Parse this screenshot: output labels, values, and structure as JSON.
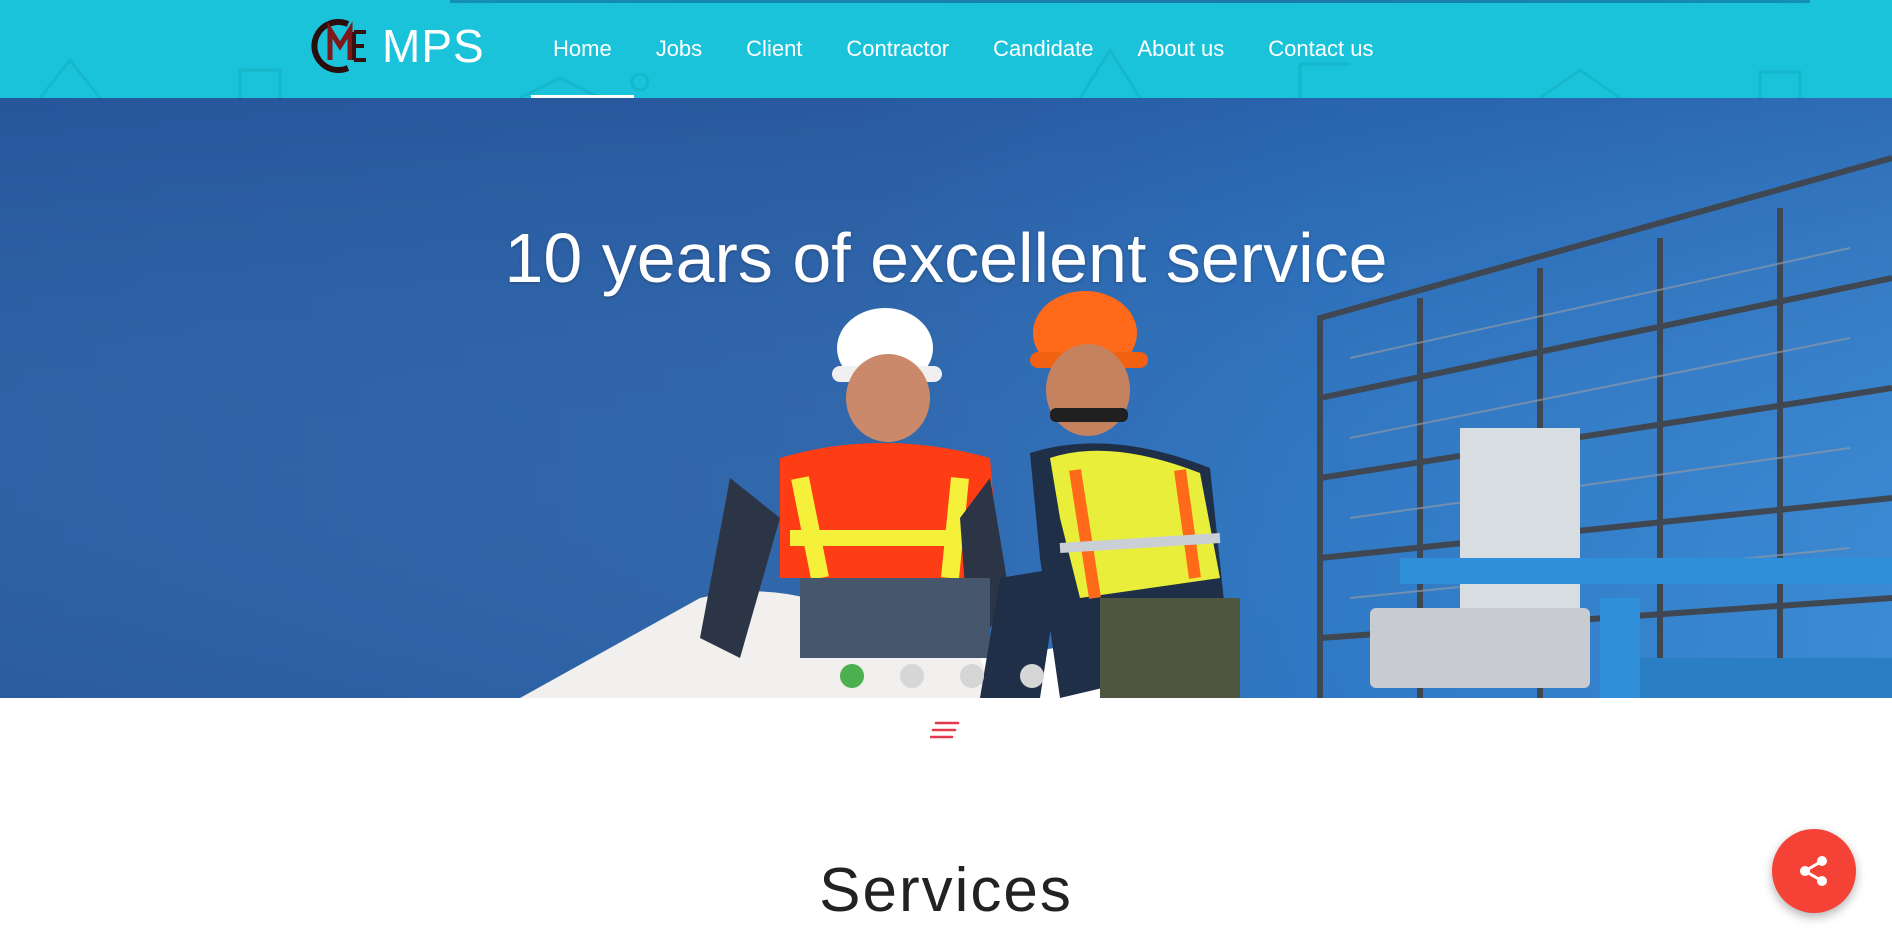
{
  "brand": {
    "name": "MPS",
    "logo_icon": "mps-logo-icon"
  },
  "nav": {
    "active_index": 0,
    "items": [
      {
        "label": "Home"
      },
      {
        "label": "Jobs"
      },
      {
        "label": "Client"
      },
      {
        "label": "Contractor"
      },
      {
        "label": "Candidate"
      },
      {
        "label": "About us"
      },
      {
        "label": "Contact us"
      }
    ]
  },
  "hero": {
    "title": "10 years of excellent service",
    "slide_count": 4,
    "active_slide": 1,
    "image": "construction-workers-photo"
  },
  "scroll_indicator": {
    "icon": "menu-lines-icon",
    "color": "#e53950"
  },
  "services": {
    "title": "Services"
  },
  "share_button": {
    "icon": "share-icon",
    "color": "#f44336"
  },
  "colors": {
    "navbar": "#1bc3da",
    "dot_active": "#4caf50",
    "dot_inactive": "#d6d6d6",
    "text_dark": "#222222"
  }
}
